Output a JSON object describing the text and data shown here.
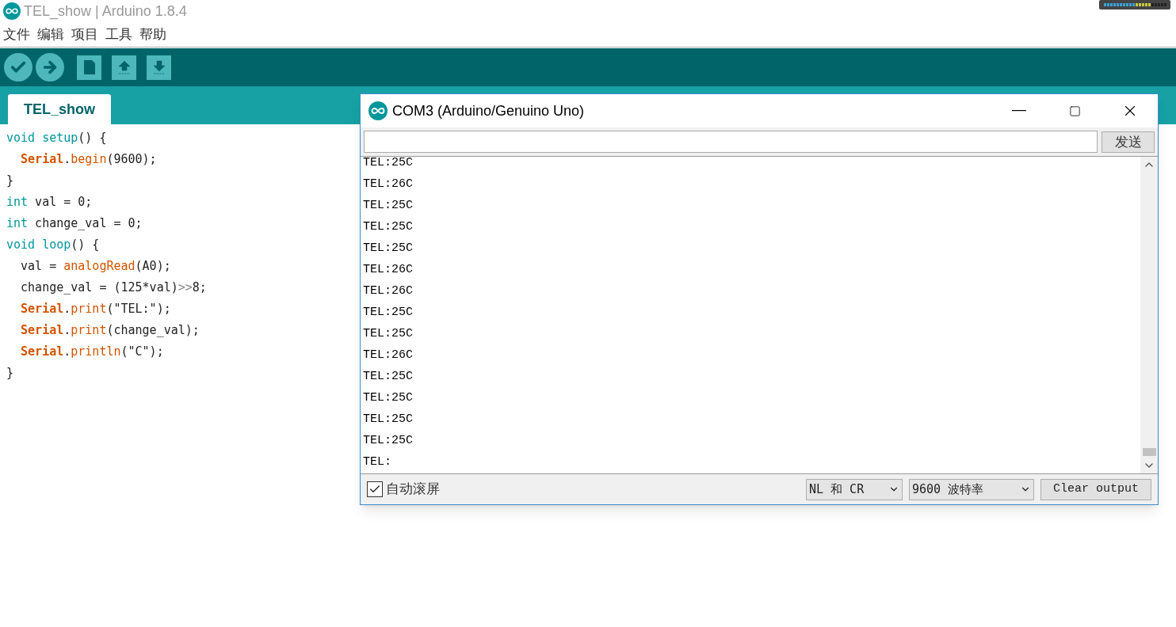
{
  "window": {
    "title": "TEL_show | Arduino 1.8.4"
  },
  "menu": [
    "文件",
    "编辑",
    "项目",
    "工具",
    "帮助"
  ],
  "tabs": [
    {
      "label": "TEL_show",
      "selected": true
    }
  ],
  "code": [
    {
      "tokens": [
        {
          "kind": "keyword",
          "text": "void setup"
        },
        {
          "kind": "plain",
          "text": "() {"
        }
      ]
    },
    {
      "tokens": [
        {
          "kind": "class",
          "text": "  Serial"
        },
        {
          "kind": "plain",
          "text": "."
        },
        {
          "kind": "func",
          "text": "begin"
        },
        {
          "kind": "plain",
          "text": "(9600);"
        }
      ]
    },
    {
      "tokens": [
        {
          "kind": "plain",
          "text": "}"
        }
      ]
    },
    {
      "tokens": [
        {
          "kind": "keyword",
          "text": "int"
        },
        {
          "kind": "plain",
          "text": " val = 0;"
        }
      ]
    },
    {
      "tokens": [
        {
          "kind": "keyword",
          "text": "int"
        },
        {
          "kind": "plain",
          "text": " change_val = 0;"
        }
      ]
    },
    {
      "tokens": [
        {
          "kind": "keyword",
          "text": "void loop"
        },
        {
          "kind": "plain",
          "text": "() {"
        }
      ]
    },
    {
      "tokens": [
        {
          "kind": "plain",
          "text": "  val = "
        },
        {
          "kind": "func",
          "text": "analogRead"
        },
        {
          "kind": "plain",
          "text": "(A0);"
        }
      ]
    },
    {
      "tokens": [
        {
          "kind": "plain",
          "text": "  change_val = (125*val)"
        },
        {
          "kind": "op",
          "text": ">>"
        },
        {
          "kind": "plain",
          "text": "8;"
        }
      ]
    },
    {
      "tokens": [
        {
          "kind": "class",
          "text": "  Serial"
        },
        {
          "kind": "plain",
          "text": "."
        },
        {
          "kind": "func",
          "text": "print"
        },
        {
          "kind": "plain",
          "text": "(\"TEL:\");"
        }
      ]
    },
    {
      "tokens": [
        {
          "kind": "class",
          "text": "  Serial"
        },
        {
          "kind": "plain",
          "text": "."
        },
        {
          "kind": "func",
          "text": "print"
        },
        {
          "kind": "plain",
          "text": "(change_val);"
        }
      ]
    },
    {
      "tokens": [
        {
          "kind": "class",
          "text": "  Serial"
        },
        {
          "kind": "plain",
          "text": "."
        },
        {
          "kind": "func",
          "text": "println"
        },
        {
          "kind": "plain",
          "text": "(\"C\");"
        }
      ]
    },
    {
      "tokens": [
        {
          "kind": "plain",
          "text": "}"
        }
      ]
    }
  ],
  "serial_monitor": {
    "title": "COM3 (Arduino/Genuino Uno)",
    "send_button": "发送",
    "output": [
      "TEL:25C",
      "TEL:26C",
      "TEL:25C",
      "TEL:25C",
      "TEL:25C",
      "TEL:26C",
      "TEL:26C",
      "TEL:25C",
      "TEL:25C",
      "TEL:26C",
      "TEL:25C",
      "TEL:25C",
      "TEL:25C",
      "TEL:25C",
      "TEL:"
    ],
    "autoscroll": {
      "label": "自动滚屏",
      "checked": true
    },
    "line_ending": "NL 和 CR",
    "baud_rate": "9600 波特率",
    "clear_button": "Clear output"
  }
}
